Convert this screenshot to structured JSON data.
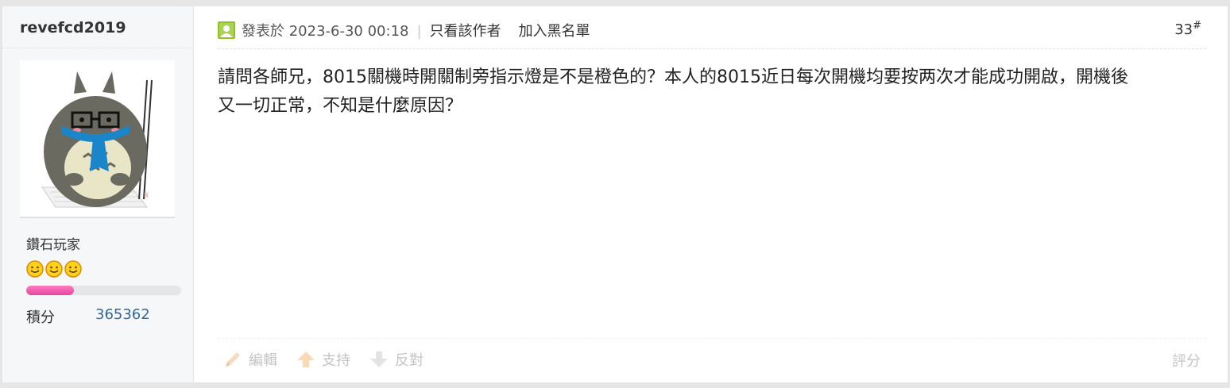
{
  "author": {
    "username": "revefcd2019",
    "group_title": "鑽石玩家",
    "star_count": 3,
    "level_progress_percent": 31,
    "points_label": "積分",
    "points_value": "365362"
  },
  "post": {
    "posted_text": "發表於 2023-6-30 00:18",
    "separator": "|",
    "only_author_label": "只看該作者",
    "blacklist_label": "加入黑名單",
    "floor_number": "33",
    "floor_suffix": "#",
    "content_line1": "請問各師兄，8015關機時開關制旁指示燈是不是橙色的？本人的8015近日每次開機均要按两次才能成功開啟，開機後",
    "content_line2": "又一切正常，不知是什麼原因？"
  },
  "actions": {
    "edit_label": "編輯",
    "support_label": "支持",
    "oppose_label": "反對",
    "rate_label": "評分"
  },
  "colors": {
    "online_icon": "#8fc31f",
    "level_bar": "#e5479f",
    "points_value": "#336699"
  },
  "icons": [
    "avatar-totoro",
    "smiley-star-icon",
    "pencil-icon",
    "arrow-up-icon",
    "arrow-down-icon",
    "online-status-icon"
  ]
}
